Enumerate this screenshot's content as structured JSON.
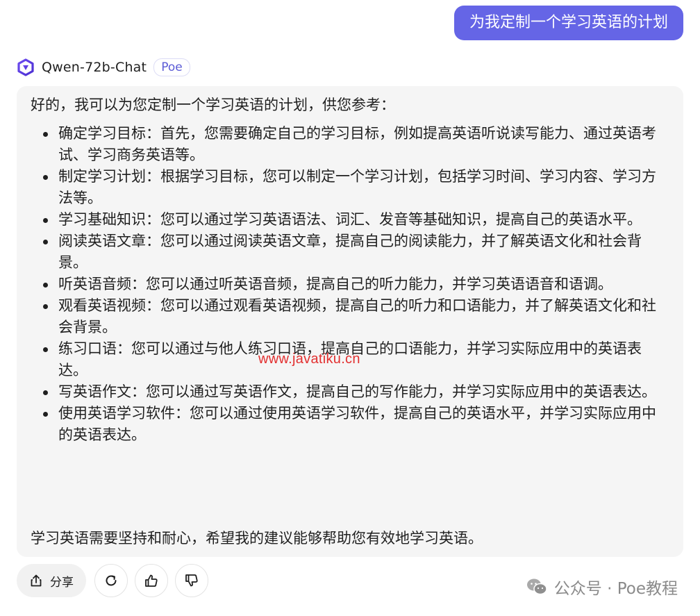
{
  "user_message": "为我定制一个学习英语的计划",
  "bot": {
    "name": "Qwen-72b-Chat",
    "badge": "Poe"
  },
  "response": {
    "intro": "好的，我可以为您定制一个学习英语的计划，供您参考：",
    "items": [
      "确定学习目标：首先，您需要确定自己的学习目标，例如提高英语听说读写能力、通过英语考试、学习商务英语等。",
      "制定学习计划：根据学习目标，您可以制定一个学习计划，包括学习时间、学习内容、学习方法等。",
      "学习基础知识：您可以通过学习英语语法、词汇、发音等基础知识，提高自己的英语水平。",
      "阅读英语文章：您可以通过阅读英语文章，提高自己的阅读能力，并了解英语文化和社会背景。",
      "听英语音频：您可以通过听英语音频，提高自己的听力能力，并学习英语语音和语调。",
      "观看英语视频：您可以通过观看英语视频，提高自己的听力和口语能力，并了解英语文化和社会背景。",
      "练习口语：您可以通过与他人练习口语，提高自己的口语能力，并学习实际应用中的英语表达。",
      "写英语作文：您可以通过写英语作文，提高自己的写作能力，并学习实际应用中的英语表达。",
      "使用英语学习软件：您可以通过使用英语学习软件，提高自己的英语水平，并学习实际应用中的英语表达。"
    ],
    "closing": "学习英语需要坚持和耐心，希望我的建议能够帮助您有效地学习英语。"
  },
  "watermark_url": "www.javatiku.cn",
  "actions": {
    "share_label": "分享"
  },
  "footer_watermark": "公众号 · Poe教程",
  "colors": {
    "accent": "#6565e6",
    "card_bg": "#f5f5f5",
    "watermark_red": "#e23030"
  }
}
